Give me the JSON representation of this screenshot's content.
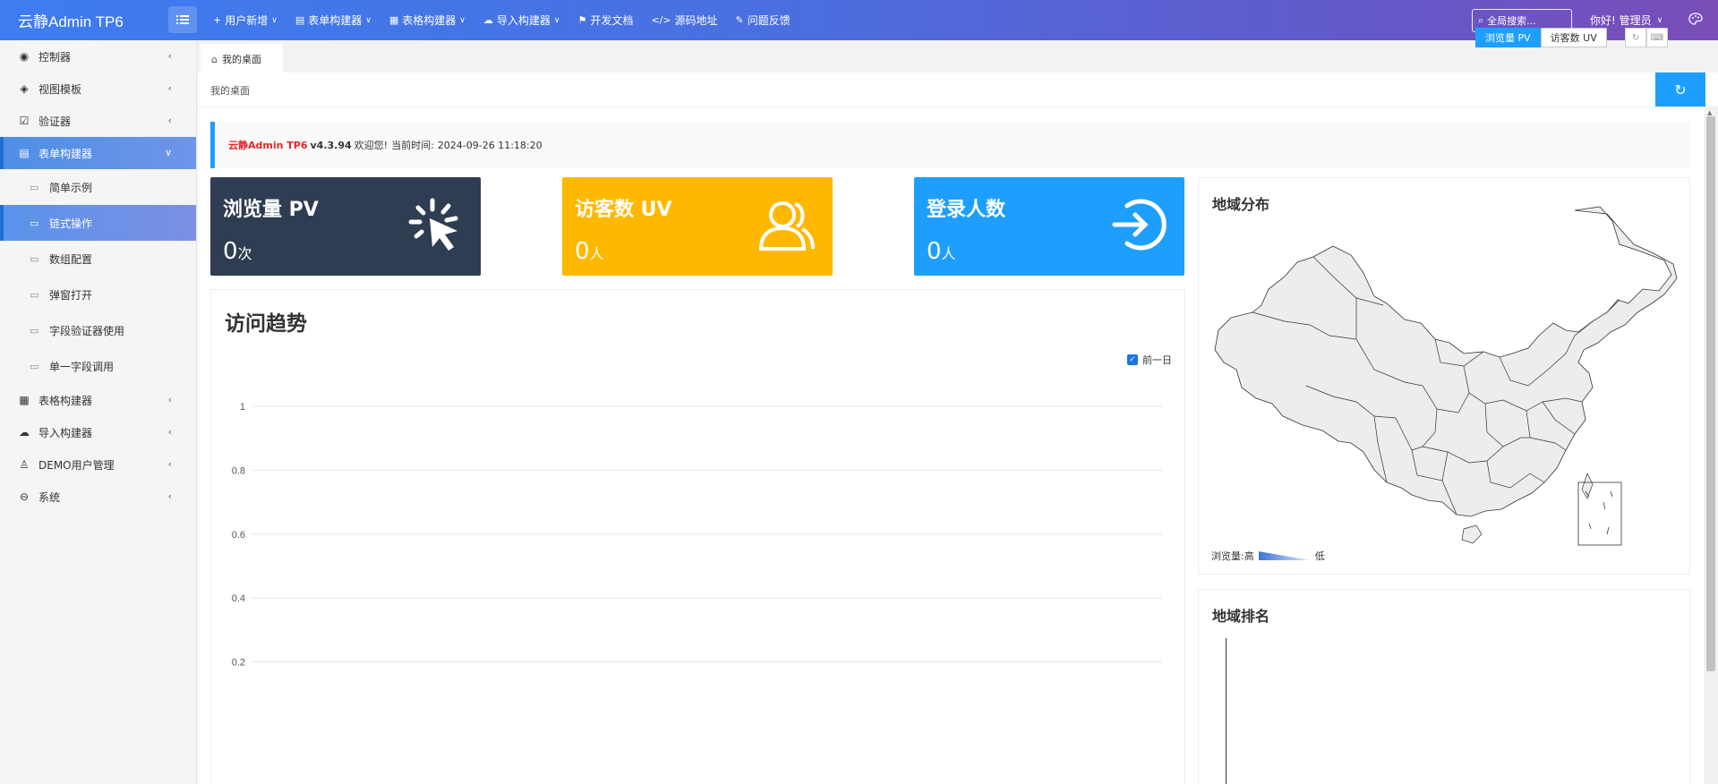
{
  "header": {
    "brand": "云静Admin TP6",
    "nav": [
      {
        "icon": "plus-icon",
        "glyph": "+",
        "label": "用户新增",
        "dropdown": true
      },
      {
        "icon": "form-icon",
        "glyph": "▤",
        "label": "表单构建器",
        "dropdown": true
      },
      {
        "icon": "table-icon",
        "glyph": "▦",
        "label": "表格构建器",
        "dropdown": true
      },
      {
        "icon": "cloud-upload-icon",
        "glyph": "☁",
        "label": "导入构建器",
        "dropdown": true
      },
      {
        "icon": "book-icon",
        "glyph": "⚑",
        "label": "开发文档",
        "dropdown": false
      },
      {
        "icon": "code-icon",
        "glyph": "</>",
        "label": "源码地址",
        "dropdown": false
      },
      {
        "icon": "feedback-icon",
        "glyph": "✎",
        "label": "问题反馈",
        "dropdown": false
      }
    ],
    "search_placeholder": "全局搜索...",
    "user_greeting": "你好! 管理员"
  },
  "sidebar": {
    "items": [
      {
        "icon": "compass-icon",
        "glyph": "◉",
        "label": "控制器",
        "expanded": false
      },
      {
        "icon": "layers-icon",
        "glyph": "◈",
        "label": "视图模板",
        "expanded": false
      },
      {
        "icon": "validator-icon",
        "glyph": "☑",
        "label": "验证器",
        "expanded": false
      },
      {
        "icon": "form-icon",
        "glyph": "▤",
        "label": "表单构建器",
        "expanded": true,
        "children": [
          {
            "label": "简单示例",
            "active": false
          },
          {
            "label": "链式操作",
            "active": true
          },
          {
            "label": "数组配置",
            "active": false
          },
          {
            "label": "弹窗打开",
            "active": false
          },
          {
            "label": "字段验证器使用",
            "active": false
          },
          {
            "label": "单一字段调用",
            "active": false
          }
        ]
      },
      {
        "icon": "table-icon",
        "glyph": "▦",
        "label": "表格构建器",
        "expanded": false
      },
      {
        "icon": "cloud-upload-icon",
        "glyph": "☁",
        "label": "导入构建器",
        "expanded": false
      },
      {
        "icon": "user-icon",
        "glyph": "♙",
        "label": "DEMO用户管理",
        "expanded": false
      },
      {
        "icon": "system-icon",
        "glyph": "⊖",
        "label": "系统",
        "expanded": false
      }
    ]
  },
  "tabs": [
    {
      "label": "我的桌面",
      "icon": "home-icon"
    }
  ],
  "breadcrumb": "我的桌面",
  "notice": {
    "brand": "云静Admin TP6",
    "version": "v4.3.94",
    "welcome": "欢迎您!",
    "time_label": "当前时间:",
    "time_value": "2024-09-26 11:18:20"
  },
  "metric_toggle": {
    "options": [
      "浏览量 PV",
      "访客数 UV"
    ],
    "selected": "浏览量 PV"
  },
  "stats": [
    {
      "label": "浏览量 PV",
      "value": "0",
      "unit": "次",
      "color": "#2f3d52",
      "icon": "click-icon"
    },
    {
      "label": "访客数 UV",
      "value": "0",
      "unit": "人",
      "color": "#ffb800",
      "icon": "users-icon"
    },
    {
      "label": "登录人数",
      "value": "0",
      "unit": "人",
      "color": "#1e9fff",
      "icon": "login-icon"
    }
  ],
  "trend": {
    "title": "访问趋势",
    "legend_label": "前一日",
    "legend_checked": true
  },
  "map": {
    "title": "地域分布",
    "legend_label": "浏览量:",
    "legend_high": "高",
    "legend_low": "低"
  },
  "ranking": {
    "title": "地域排名"
  },
  "chart_data": {
    "type": "line",
    "title": "访问趋势",
    "series": [
      {
        "name": "前一日",
        "values": []
      }
    ],
    "y_ticks": [
      0.2,
      0.4,
      0.6,
      0.8,
      1
    ],
    "ylim": [
      0,
      1
    ],
    "grid": true,
    "legend": "top-right"
  },
  "colors": {
    "accent": "#1e9fff",
    "brand_red": "#e8262b",
    "card_dark": "#2f3d52",
    "card_yellow": "#ffb800",
    "card_blue": "#1e9fff"
  }
}
